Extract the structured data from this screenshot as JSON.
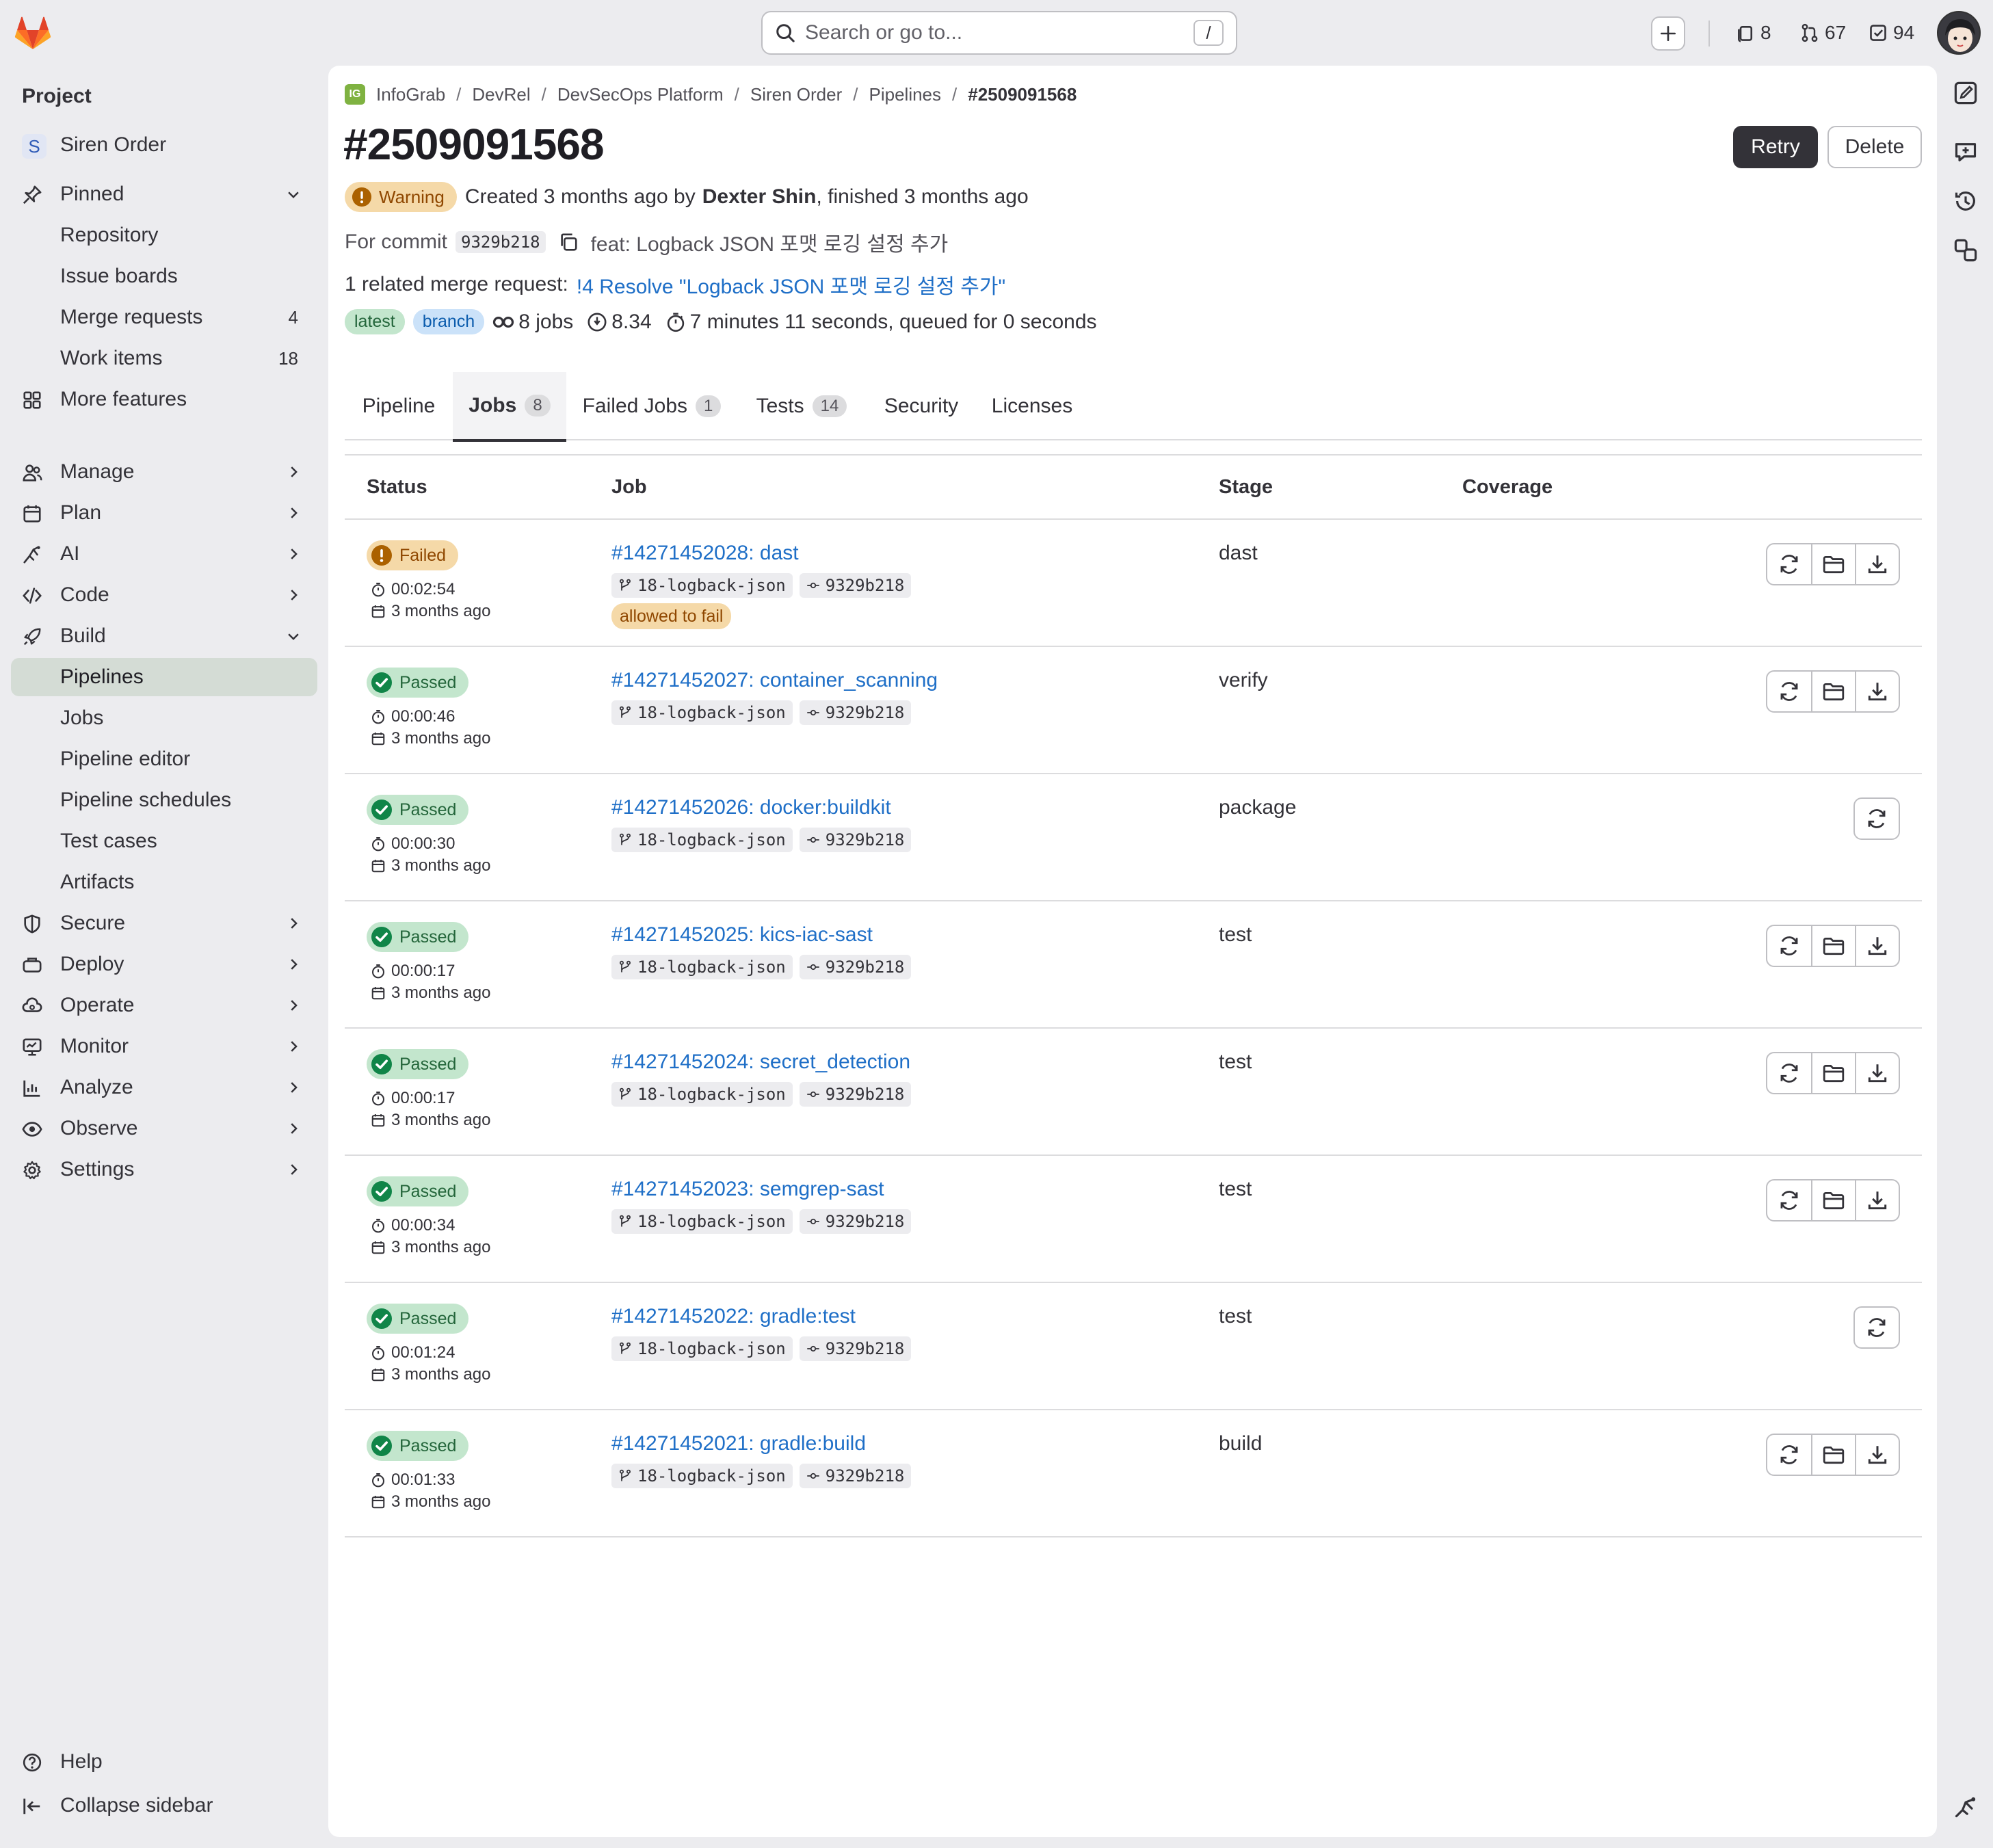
{
  "search": {
    "placeholder": "Search or go to...",
    "shortcut": "/"
  },
  "top_counts": {
    "issues": "8",
    "merge_requests": "67",
    "todos": "94"
  },
  "sidebar": {
    "heading": "Project",
    "project_name": "Siren Order",
    "project_initial": "S",
    "pinned": "Pinned",
    "pinned_items": [
      {
        "label": "Repository",
        "count": ""
      },
      {
        "label": "Issue boards",
        "count": ""
      },
      {
        "label": "Merge requests",
        "count": "4"
      },
      {
        "label": "Work items",
        "count": "18"
      }
    ],
    "more_features": "More features",
    "sections": [
      "Manage",
      "Plan",
      "AI",
      "Code",
      "Build"
    ],
    "build_items": [
      "Pipelines",
      "Jobs",
      "Pipeline editor",
      "Pipeline schedules",
      "Test cases",
      "Artifacts"
    ],
    "sections_after": [
      "Secure",
      "Deploy",
      "Operate",
      "Monitor",
      "Analyze",
      "Observe",
      "Settings"
    ],
    "help": "Help",
    "collapse": "Collapse sidebar"
  },
  "breadcrumb": [
    "InfoGrab",
    "DevRel",
    "DevSecOps Platform",
    "Siren Order",
    "Pipelines",
    "#2509091568"
  ],
  "breadcrumb_logo": "IG",
  "pipeline": {
    "title": "#2509091568",
    "retry_label": "Retry",
    "delete_label": "Delete",
    "status": "Warning",
    "created_prefix": "Created 3 months ago by",
    "author": "Dexter Shin",
    "finished": ", finished 3 months ago",
    "commit_prefix": "For commit",
    "commit_sha": "9329b218",
    "commit_message": "feat: Logback JSON 포맷 로깅 설정 추가",
    "mr_prefix": "1 related merge request:",
    "mr_link": "!4 Resolve \"Logback JSON 포맷 로깅 설정 추가\"",
    "tag_latest": "latest",
    "tag_branch": "branch",
    "jobs_count": "8 jobs",
    "compute": "8.34",
    "duration": "7 minutes 11 seconds, queued for 0 seconds"
  },
  "tabs": [
    {
      "label": "Pipeline",
      "count": ""
    },
    {
      "label": "Jobs",
      "count": "8"
    },
    {
      "label": "Failed Jobs",
      "count": "1"
    },
    {
      "label": "Tests",
      "count": "14"
    },
    {
      "label": "Security",
      "count": ""
    },
    {
      "label": "Licenses",
      "count": ""
    }
  ],
  "table_headers": {
    "status": "Status",
    "job": "Job",
    "stage": "Stage",
    "coverage": "Coverage"
  },
  "jobs": [
    {
      "status": "Failed",
      "duration": "00:02:54",
      "ago": "3 months ago",
      "name": "#14271452028: dast",
      "ref": "18-logback-json",
      "sha": "9329b218",
      "tag": "allowed to fail",
      "stage": "dast"
    },
    {
      "status": "Passed",
      "duration": "00:00:46",
      "ago": "3 months ago",
      "name": "#14271452027: container_scanning",
      "ref": "18-logback-json",
      "sha": "9329b218",
      "tag": "",
      "stage": "verify"
    },
    {
      "status": "Passed",
      "duration": "00:00:30",
      "ago": "3 months ago",
      "name": "#14271452026: docker:buildkit",
      "ref": "18-logback-json",
      "sha": "9329b218",
      "tag": "",
      "stage": "package"
    },
    {
      "status": "Passed",
      "duration": "00:00:17",
      "ago": "3 months ago",
      "name": "#14271452025: kics-iac-sast",
      "ref": "18-logback-json",
      "sha": "9329b218",
      "tag": "",
      "stage": "test"
    },
    {
      "status": "Passed",
      "duration": "00:00:17",
      "ago": "3 months ago",
      "name": "#14271452024: secret_detection",
      "ref": "18-logback-json",
      "sha": "9329b218",
      "tag": "",
      "stage": "test"
    },
    {
      "status": "Passed",
      "duration": "00:00:34",
      "ago": "3 months ago",
      "name": "#14271452023: semgrep-sast",
      "ref": "18-logback-json",
      "sha": "9329b218",
      "tag": "",
      "stage": "test"
    },
    {
      "status": "Passed",
      "duration": "00:01:24",
      "ago": "3 months ago",
      "name": "#14271452022: gradle:test",
      "ref": "18-logback-json",
      "sha": "9329b218",
      "tag": "",
      "stage": "test"
    },
    {
      "status": "Passed",
      "duration": "00:01:33",
      "ago": "3 months ago",
      "name": "#14271452021: gradle:build",
      "ref": "18-logback-json",
      "sha": "9329b218",
      "tag": "",
      "stage": "build"
    }
  ],
  "colors": {
    "accent_link": "#1f6fc7",
    "passed": "#108548",
    "failed": "#c17d10",
    "active_nav": "#d4dcd5"
  }
}
